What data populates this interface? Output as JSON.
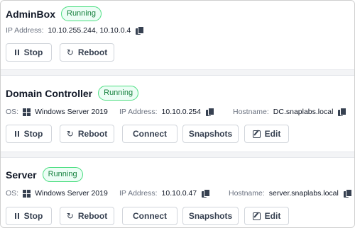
{
  "vms": [
    {
      "name": "AdminBox",
      "status": "Running",
      "ip_label": "IP Address:",
      "ip_value": "10.10.255.244, 10.10.0.4",
      "buttons": {
        "stop": "Stop",
        "reboot": "Reboot"
      }
    },
    {
      "name": "Domain Controller",
      "status": "Running",
      "os_label": "OS:",
      "os_value": "Windows Server 2019",
      "ip_label": "IP Address:",
      "ip_value": "10.10.0.254",
      "hostname_label": "Hostname:",
      "hostname_value": "DC.snaplabs.local",
      "buttons": {
        "stop": "Stop",
        "reboot": "Reboot",
        "connect": "Connect",
        "snapshots": "Snapshots",
        "edit": "Edit"
      }
    },
    {
      "name": "Server",
      "status": "Running",
      "os_label": "OS:",
      "os_value": "Windows Server 2019",
      "ip_label": "IP Address:",
      "ip_value": "10.10.0.47",
      "hostname_label": "Hostname:",
      "hostname_value": "server.snaplabs.local",
      "buttons": {
        "stop": "Stop",
        "reboot": "Reboot",
        "connect": "Connect",
        "snapshots": "Snapshots",
        "edit": "Edit"
      }
    }
  ],
  "colors": {
    "status_text": "#15803d",
    "status_border": "#4ade80",
    "status_bg": "#ecfdf5"
  },
  "icons": {
    "stop": "pause-icon",
    "reboot": "reboot-icon",
    "edit": "edit-icon",
    "copy": "copy-icon",
    "os": "windows-icon"
  }
}
